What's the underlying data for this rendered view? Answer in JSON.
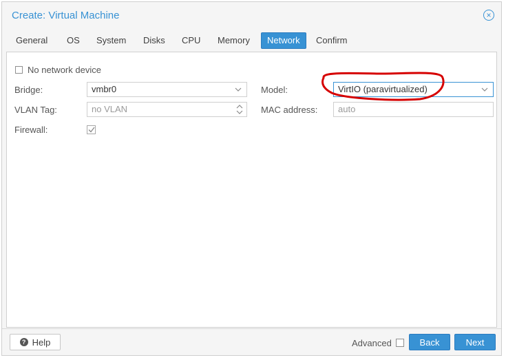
{
  "window": {
    "title": "Create: Virtual Machine"
  },
  "tabs": [
    {
      "label": "General"
    },
    {
      "label": "OS"
    },
    {
      "label": "System"
    },
    {
      "label": "Disks"
    },
    {
      "label": "CPU"
    },
    {
      "label": "Memory"
    },
    {
      "label": "Network",
      "active": true
    },
    {
      "label": "Confirm"
    }
  ],
  "form": {
    "no_network_label": "No network device",
    "no_network_checked": false,
    "bridge_label": "Bridge:",
    "bridge_value": "vmbr0",
    "vlan_label": "VLAN Tag:",
    "vlan_value": "no VLAN",
    "firewall_label": "Firewall:",
    "firewall_checked": true,
    "model_label": "Model:",
    "model_value": "VirtIO (paravirtualized)",
    "mac_label": "MAC address:",
    "mac_placeholder": "auto"
  },
  "footer": {
    "help_label": "Help",
    "advanced_label": "Advanced",
    "advanced_checked": false,
    "back_label": "Back",
    "next_label": "Next"
  },
  "colors": {
    "accent": "#3892d4",
    "annotation": "#d60000"
  },
  "icons": {
    "close": "close-circle-icon",
    "help": "question-circle-icon",
    "dropdown": "chevron-down-icon",
    "spinner": "spinner-arrows-icon",
    "check": "checkmark-icon"
  }
}
